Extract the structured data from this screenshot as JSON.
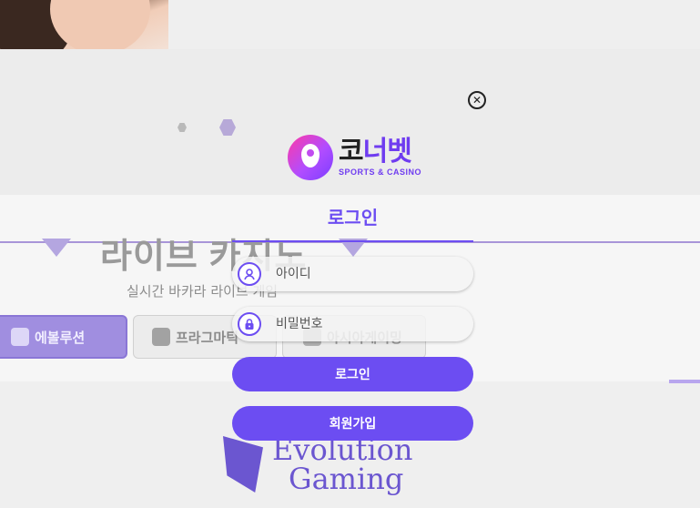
{
  "background": {
    "section_title": "라이브 카지노",
    "section_subtitle": "실시간 바카라 라이브 게임",
    "provider_tabs": [
      {
        "label": "에볼루션"
      },
      {
        "label": "프라그마틱"
      },
      {
        "label": "아시아게이밍"
      }
    ],
    "featured_provider": {
      "line1": "Evolution",
      "line2": "Gaming"
    }
  },
  "modal": {
    "close_icon": "close-circle-icon",
    "logo": {
      "korean_prefix": "코",
      "korean_accent": "너벳",
      "tagline": "SPORTS & CASINO"
    },
    "title": "로그인",
    "username": {
      "placeholder": "아이디",
      "value": "",
      "icon": "user-icon"
    },
    "password": {
      "placeholder": "비밀번호",
      "value": "",
      "icon": "lock-icon"
    },
    "login_button": "로그인",
    "signup_button": "회원가입"
  },
  "colors": {
    "accent": "#6c4df2",
    "logo_gradient_start": "#ff3aa5",
    "logo_gradient_end": "#7b3dff"
  }
}
